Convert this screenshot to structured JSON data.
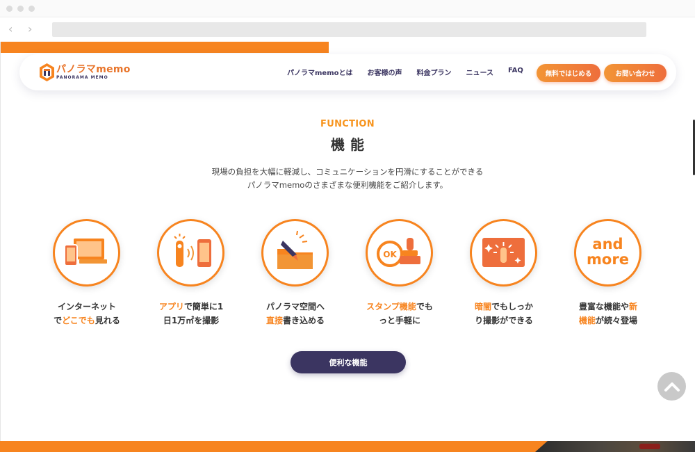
{
  "browser": {
    "back_icon": "chevron-left-icon",
    "forward_icon": "chevron-right-icon"
  },
  "header": {
    "logo_text": "パノラマmemo",
    "logo_sub": "PANORAMA MEMO",
    "nav": [
      "パノラマmemoとは",
      "お客様の声",
      "料金プラン",
      "ニュース",
      "FAQ"
    ],
    "cta_free": "無料ではじめる",
    "cta_contact": "お問い合わせ"
  },
  "function_section": {
    "label": "FUNCTION",
    "title": "機能",
    "description_line1": "現場の負担を大幅に軽減し、コミュニケーションを円滑にすることができる",
    "description_line2": "パノラマmemoのさまざまな便利機能をご紹介します。",
    "features": [
      {
        "icon": "devices-icon",
        "line1_hl": "",
        "line1": "インターネット",
        "line2_pre": "で",
        "line2_hl": "どこでも",
        "line2": "見れる"
      },
      {
        "icon": "app-camera-icon",
        "line1_hl": "アプリ",
        "line1": "で簡単に1",
        "line2_pre": "",
        "line2_hl": "",
        "line2": "日1万㎡を撮影"
      },
      {
        "icon": "pen-folder-icon",
        "line1_hl": "",
        "line1": "パノラマ空間へ",
        "line2_pre": "",
        "line2_hl": "直接",
        "line2": "書き込める"
      },
      {
        "icon": "stamp-icon",
        "line1_hl": "スタンプ機能",
        "line1": "でも",
        "line2_pre": "",
        "line2_hl": "",
        "line2": "っと手軽に"
      },
      {
        "icon": "dark-shooting-icon",
        "line1_hl": "暗闇",
        "line1": "でもしっか",
        "line2_pre": "",
        "line2_hl": "",
        "line2": "り撮影ができる"
      },
      {
        "icon": "and-more-icon",
        "line1_hl": "",
        "line1": "豊富な機能や",
        "line1_post_hl": "新",
        "line2_pre": "",
        "line2_hl": "機能",
        "line2": "が続々登場",
        "more_line1": "and",
        "more_line2": "more"
      }
    ],
    "button": "便利な機能"
  },
  "colors": {
    "accent_orange": "#f7841f",
    "navy": "#3b3561"
  }
}
